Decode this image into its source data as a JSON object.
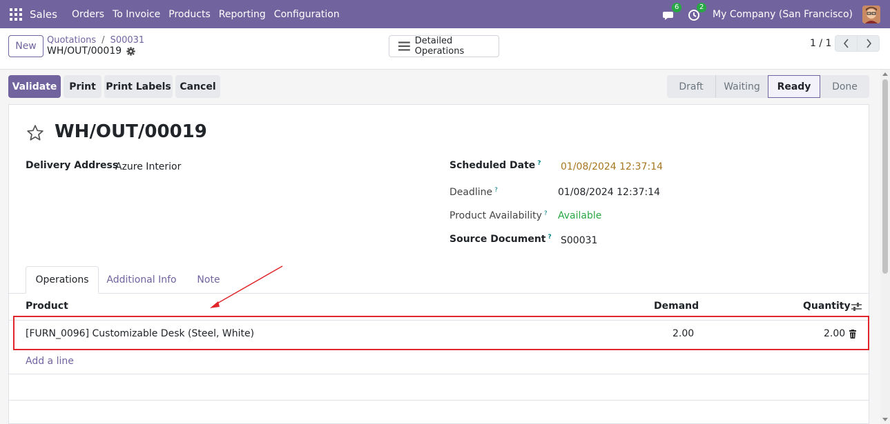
{
  "topbar": {
    "app_name": "Sales",
    "menu": [
      "Orders",
      "To Invoice",
      "Products",
      "Reporting",
      "Configuration"
    ],
    "chat_count": "6",
    "activity_count": "2",
    "company": "My Company (San Francisco)"
  },
  "control_panel": {
    "new_label": "New",
    "breadcrumb": [
      "Quotations",
      "S00031"
    ],
    "record_name": "WH/OUT/00019",
    "detailed_ops_label": "Detailed Operations",
    "pager": "1 / 1"
  },
  "actions": {
    "validate": "Validate",
    "print": "Print",
    "print_labels": "Print Labels",
    "cancel": "Cancel"
  },
  "status_stages": [
    "Draft",
    "Waiting",
    "Ready",
    "Done"
  ],
  "active_stage": "Ready",
  "form": {
    "title": "WH/OUT/00019",
    "delivery_address_label": "Delivery Address",
    "delivery_address": "Azure Interior",
    "scheduled_date_label": "Scheduled Date",
    "scheduled_date": "01/08/2024 12:37:14",
    "deadline_label": "Deadline",
    "deadline": "01/08/2024 12:37:14",
    "availability_label": "Product Availability",
    "availability": "Available",
    "source_label": "Source Document",
    "source": "S00031",
    "help_mark": "?"
  },
  "tabs": [
    "Operations",
    "Additional Info",
    "Note"
  ],
  "table": {
    "headers": {
      "product": "Product",
      "demand": "Demand",
      "quantity": "Quantity"
    },
    "rows": [
      {
        "product": "[FURN_0096] Customizable Desk (Steel, White)",
        "demand": "2.00",
        "quantity": "2.00"
      }
    ],
    "add_line": "Add a line"
  },
  "colors": {
    "brand": "#71639e",
    "highlight": "#e0262a",
    "available": "#28a745",
    "scheduled": "#a6761d"
  }
}
